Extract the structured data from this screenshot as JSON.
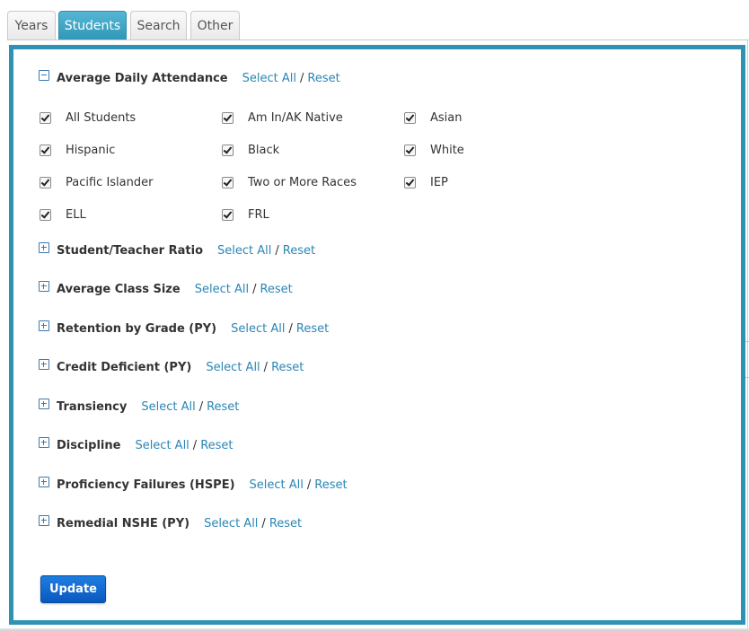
{
  "tabs": [
    {
      "label": "Years"
    },
    {
      "label": "Students"
    },
    {
      "label": "Search"
    },
    {
      "label": "Other"
    }
  ],
  "select_all_label": "Select All",
  "separator": "/",
  "reset_label": "Reset",
  "sections": [
    {
      "title": "Average Daily Attendance",
      "expanded": true,
      "options": [
        {
          "label": "All Students",
          "checked": true
        },
        {
          "label": "Am In/AK Native",
          "checked": true
        },
        {
          "label": "Asian",
          "checked": true
        },
        {
          "label": "Hispanic",
          "checked": true
        },
        {
          "label": "Black",
          "checked": true
        },
        {
          "label": "White",
          "checked": true
        },
        {
          "label": "Pacific Islander",
          "checked": true
        },
        {
          "label": "Two or More Races",
          "checked": true
        },
        {
          "label": "IEP",
          "checked": true
        },
        {
          "label": "ELL",
          "checked": true
        },
        {
          "label": "FRL",
          "checked": true
        }
      ]
    },
    {
      "title": "Student/Teacher Ratio",
      "expanded": false
    },
    {
      "title": "Average Class Size",
      "expanded": false
    },
    {
      "title": "Retention by Grade (PY)",
      "expanded": false
    },
    {
      "title": "Credit Deficient (PY)",
      "expanded": false
    },
    {
      "title": "Transiency",
      "expanded": false
    },
    {
      "title": "Discipline",
      "expanded": false
    },
    {
      "title": "Proficiency Failures (HSPE)",
      "expanded": false
    },
    {
      "title": "Remedial NSHE (PY)",
      "expanded": false
    }
  ],
  "update_button": "Update",
  "colors": {
    "accent": "#2e93b3",
    "link": "#2a86b5",
    "button": "#0a58c0"
  }
}
